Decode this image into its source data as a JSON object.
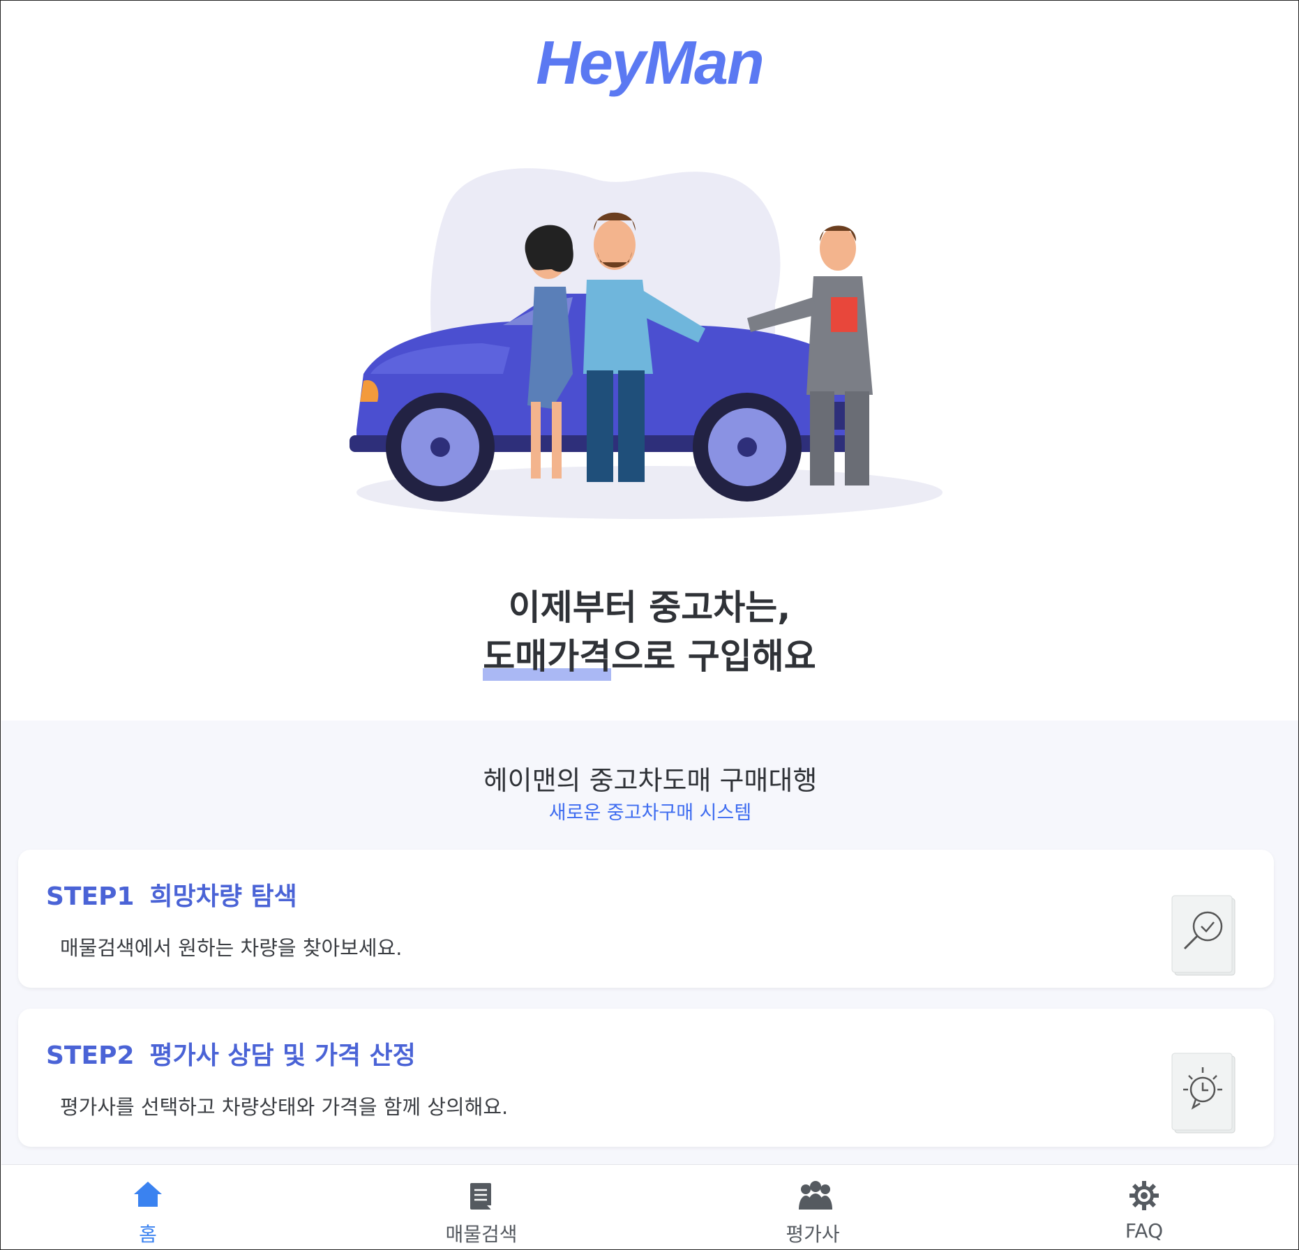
{
  "brand": {
    "logo_text": "HeyMan",
    "primary_color": "#5b79f2"
  },
  "hero": {
    "headline_line1": "이제부터 중고차는,",
    "headline_highlight": "도매가격",
    "headline_line2_rest": "으로 구입해요"
  },
  "intro": {
    "title": "헤이맨의 중고차도매 구매대행",
    "subtitle": "새로운 중고차구매 시스템"
  },
  "steps": [
    {
      "number": "STEP1",
      "title": "희망차량 탐색",
      "description": "매물검색에서 원하는 차량을 찾아보세요.",
      "icon": "search-document-icon"
    },
    {
      "number": "STEP2",
      "title": "평가사 상담 및 가격 산정",
      "description": "평가사를 선택하고 차량상태와 가격을 함께 상의해요.",
      "icon": "idea-clock-icon"
    }
  ],
  "tabbar": {
    "active_color": "#3a82f0",
    "items": [
      {
        "label": "홈",
        "icon": "home-icon",
        "active": true
      },
      {
        "label": "매물검색",
        "icon": "document-icon",
        "active": false
      },
      {
        "label": "평가사",
        "icon": "people-icon",
        "active": false
      },
      {
        "label": "FAQ",
        "icon": "gear-icon",
        "active": false
      }
    ]
  }
}
